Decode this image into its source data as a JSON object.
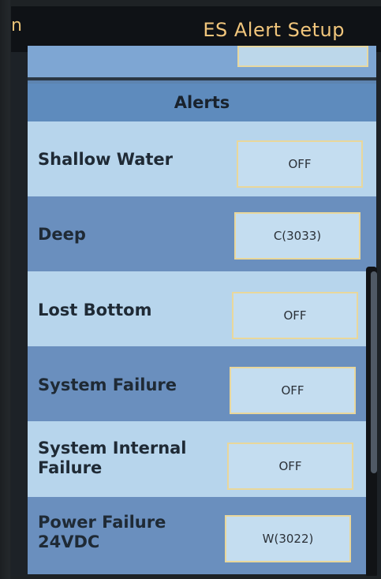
{
  "title_bar": {
    "left_fragment": "n",
    "title": "ES Alert Setup"
  },
  "section": {
    "header": "Alerts"
  },
  "alerts": [
    {
      "label": "Shallow Water",
      "value": "OFF"
    },
    {
      "label": "Deep",
      "value": "C(3033)"
    },
    {
      "label": "Lost Bottom",
      "value": "OFF"
    },
    {
      "label": "System Failure",
      "value": "OFF"
    },
    {
      "label": "System Internal\nFailure",
      "value": "OFF"
    },
    {
      "label": "Power Failure\n24VDC",
      "value": "W(3022)"
    }
  ],
  "colors": {
    "title_text": "#f1c67c",
    "row_light": "#b7d5ec",
    "row_dark": "#6a8fbe",
    "header": "#5e8bbd",
    "value_box_border": "#e9d79b"
  }
}
